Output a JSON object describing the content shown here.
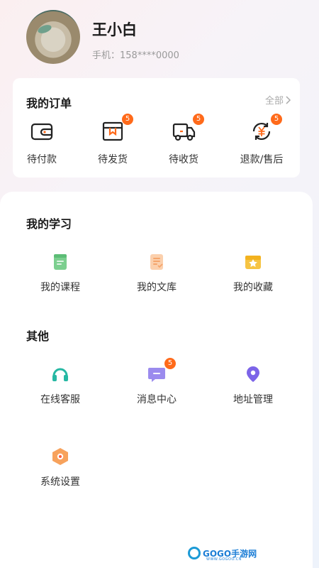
{
  "profile": {
    "name": "王小白",
    "phone": "手机：158****0000"
  },
  "orders": {
    "title": "我的订单",
    "all_label": "全部",
    "items": [
      {
        "label": "待付款",
        "icon": "wallet-icon",
        "badge": ""
      },
      {
        "label": "待发货",
        "icon": "box-icon",
        "badge": "5"
      },
      {
        "label": "待收货",
        "icon": "truck-icon",
        "badge": "5"
      },
      {
        "label": "退款/售后",
        "icon": "refund-icon",
        "badge": "5"
      }
    ]
  },
  "learning": {
    "title": "我的学习",
    "items": [
      {
        "label": "我的课程",
        "icon": "course-book-icon",
        "color": "#7ccf8f"
      },
      {
        "label": "我的文库",
        "icon": "document-library-icon",
        "color": "#f5a56b"
      },
      {
        "label": "我的收藏",
        "icon": "favorite-star-icon",
        "color": "#f6c443"
      }
    ]
  },
  "other": {
    "title": "其他",
    "items": [
      {
        "label": "在线客服",
        "icon": "headset-icon",
        "color": "#26b8a3",
        "badge": ""
      },
      {
        "label": "消息中心",
        "icon": "message-icon",
        "color": "#9b8bee",
        "badge": "5"
      },
      {
        "label": "地址管理",
        "icon": "location-pin-icon",
        "color": "#7c64e8",
        "badge": ""
      },
      {
        "label": "系统设置",
        "icon": "settings-hexagon-icon",
        "color": "#f7a25c",
        "badge": ""
      }
    ]
  },
  "watermark": {
    "text": "GOGO手游网",
    "sub": "WWW.GOGOO.CN"
  },
  "colors": {
    "badge": "#ff6a1a",
    "accent_blue": "#1c7ed6"
  }
}
